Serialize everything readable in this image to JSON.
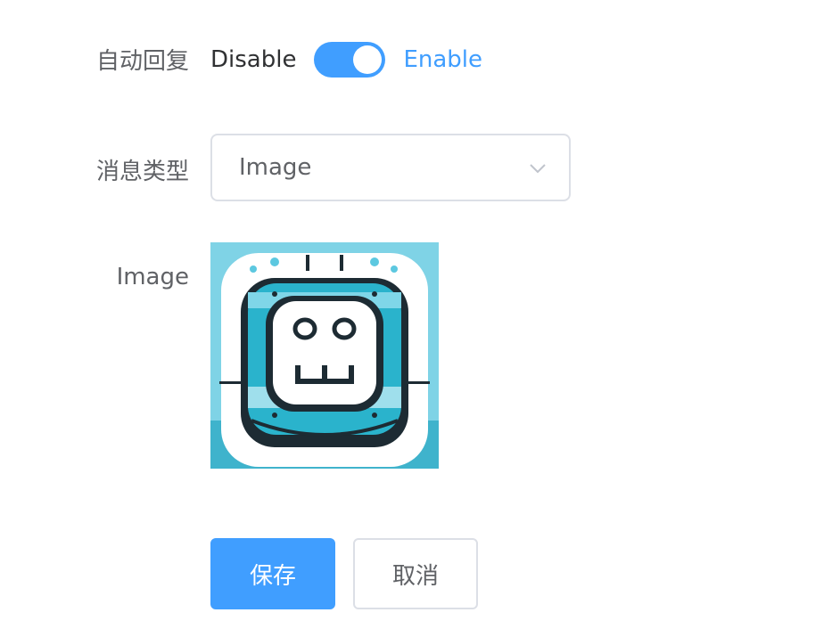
{
  "form": {
    "auto_reply": {
      "label": "自动回复",
      "off_text": "Disable",
      "on_text": "Enable",
      "enabled": true
    },
    "message_type": {
      "label": "消息类型",
      "selected": "Image"
    },
    "image": {
      "label": "Image",
      "icon": "robot-avatar-icon"
    },
    "actions": {
      "save_label": "保存",
      "cancel_label": "取消"
    }
  },
  "colors": {
    "primary": "#409eff",
    "label": "#606266",
    "border": "#dcdfe6"
  }
}
